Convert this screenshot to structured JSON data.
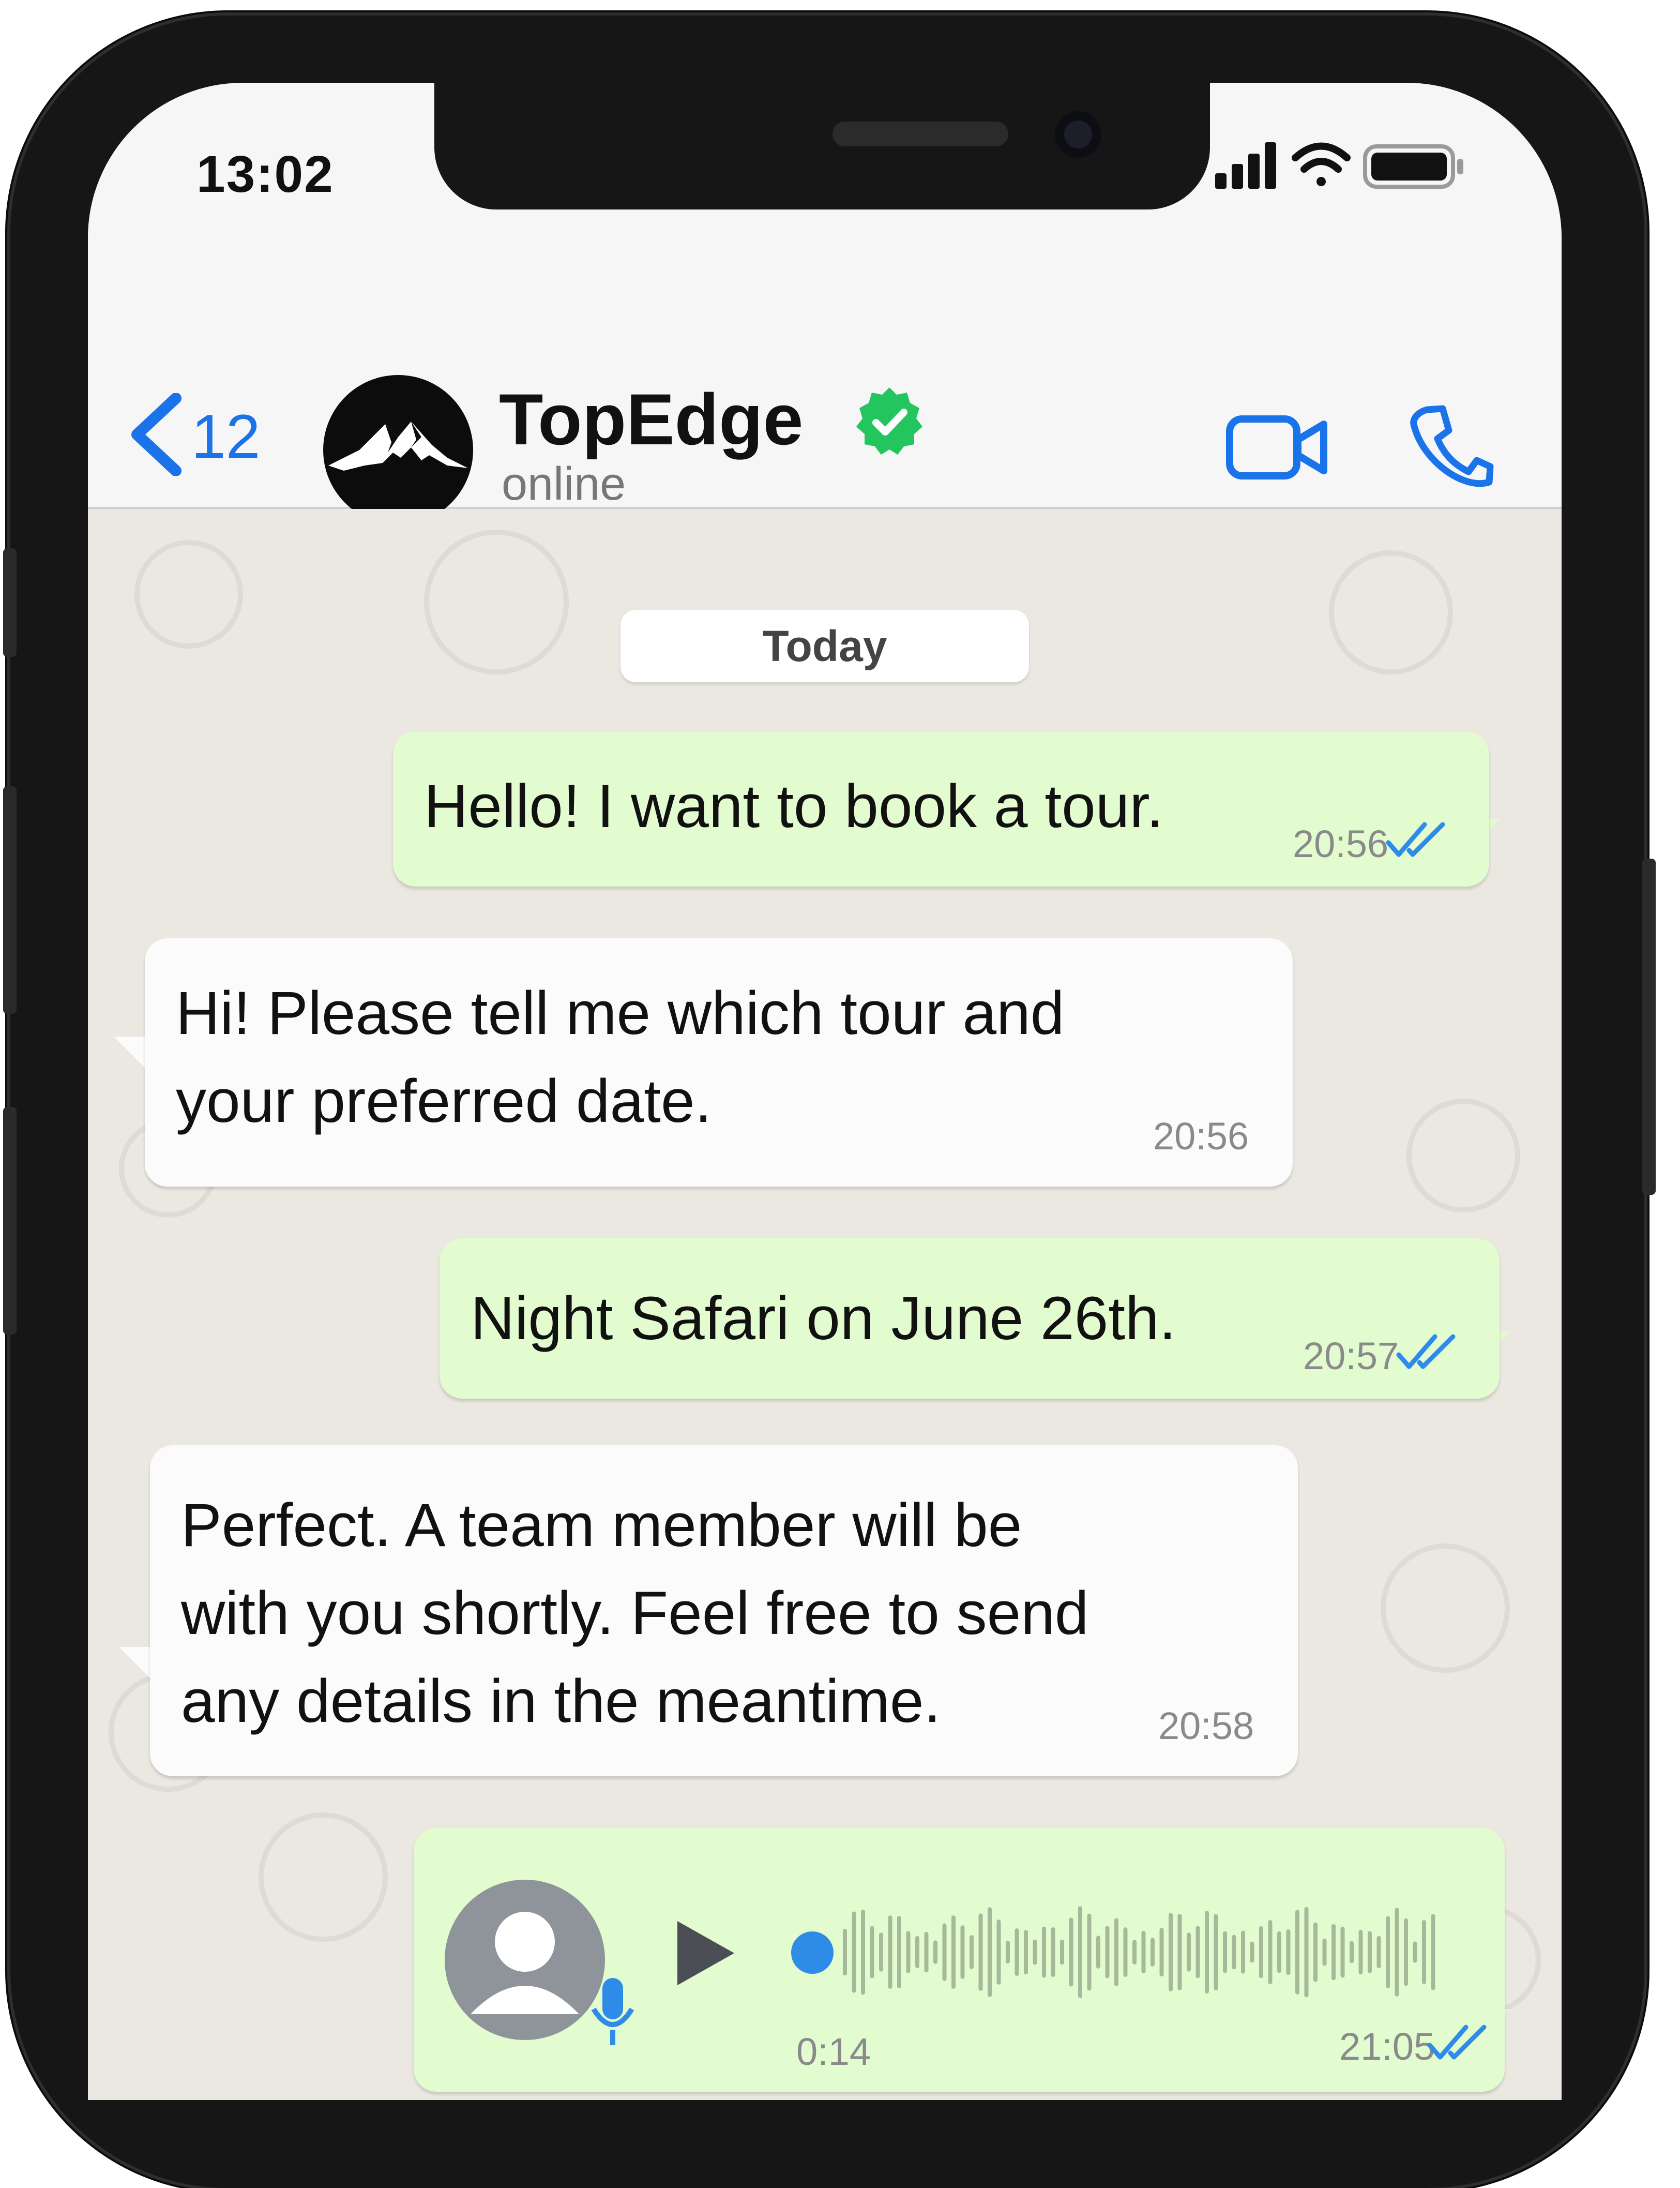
{
  "status_bar": {
    "time": "13:02",
    "icons": [
      "signal-icon",
      "wifi-icon",
      "battery-icon"
    ]
  },
  "header": {
    "back_count": "12",
    "contact_name": "TopEdge",
    "contact_status": "online",
    "verified": true,
    "actions": [
      "video-call-icon",
      "phone-call-icon"
    ]
  },
  "chat": {
    "date_label": "Today",
    "messages": [
      {
        "direction": "outgoing",
        "text": "Hello! I want to book a tour.",
        "time": "20:56",
        "status": "read"
      },
      {
        "direction": "incoming",
        "lines": [
          "Hi! Please tell me which tour and",
          "your preferred date."
        ],
        "time": "20:56"
      },
      {
        "direction": "outgoing",
        "text": "Night Safari on June 26th.",
        "time": "20:57",
        "status": "read"
      },
      {
        "direction": "incoming",
        "lines": [
          "Perfect. A team member will be",
          "with you shortly. Feel free to send",
          "any details in the meantime."
        ],
        "time": "20:58"
      },
      {
        "direction": "outgoing",
        "type": "voice",
        "duration": "0:14",
        "time": "21:05",
        "status": "read",
        "progress": 0
      }
    ]
  },
  "colors": {
    "accent_blue": "#1a73e8",
    "verified_green": "#22c55e",
    "outgoing_bubble": "#e2fbcf",
    "incoming_bubble": "#fbfbfb",
    "read_ticks": "#2f8be8"
  }
}
